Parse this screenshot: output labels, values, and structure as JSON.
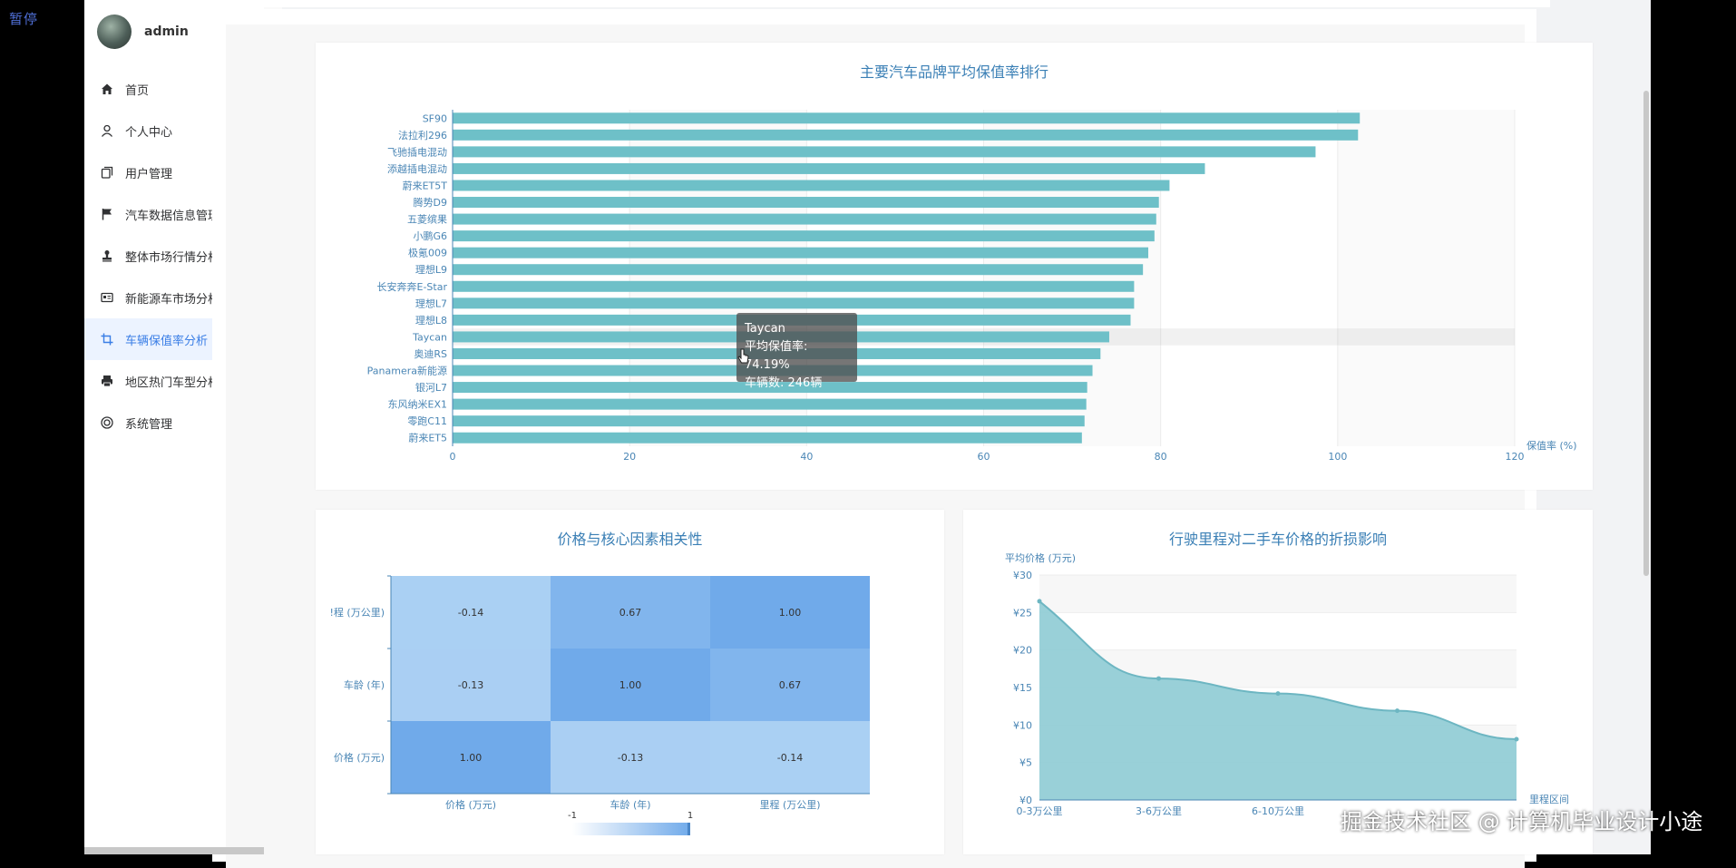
{
  "overlay": {
    "pause_label": "暂停",
    "watermark": "掘金技术社区 @ 计算机毕业设计小途"
  },
  "sidebar": {
    "username": "admin",
    "items": [
      {
        "label": "首页",
        "icon": "home-icon",
        "expand": false,
        "active": false
      },
      {
        "label": "个人中心",
        "icon": "user-icon",
        "expand": true,
        "active": false
      },
      {
        "label": "用户管理",
        "icon": "copy-icon",
        "expand": false,
        "active": false
      },
      {
        "label": "汽车数据信息管理",
        "icon": "flag-icon",
        "expand": false,
        "active": false
      },
      {
        "label": "整体市场行情分析",
        "icon": "stamp-icon",
        "expand": false,
        "active": false
      },
      {
        "label": "新能源车市场分析",
        "icon": "id-card-icon",
        "expand": false,
        "active": false
      },
      {
        "label": "车辆保值率分析",
        "icon": "crop-icon",
        "expand": false,
        "active": true
      },
      {
        "label": "地区热门车型分析",
        "icon": "printer-icon",
        "expand": false,
        "active": false
      },
      {
        "label": "系统管理",
        "icon": "settings-circle-icon",
        "expand": true,
        "active": false
      }
    ]
  },
  "chart_data": [
    {
      "type": "bar",
      "orientation": "horizontal",
      "title": "主要汽车品牌平均保值率排行",
      "xlabel": "保值率 (%)",
      "xlim": [
        0,
        120
      ],
      "xticks": [
        "0",
        "20",
        "40",
        "60",
        "80",
        "100",
        "120"
      ],
      "categories": [
        "SF90",
        "法拉利296",
        "飞驰插电混动",
        "添越插电混动",
        "蔚来ET5T",
        "腾势D9",
        "五菱缤果",
        "小鹏G6",
        "极氪009",
        "理想L9",
        "长安奔奔E-Star",
        "理想L7",
        "理想L8",
        "Taycan",
        "奥迪RS",
        "Panamera新能源",
        "银河L7",
        "东风纳米EX1",
        "零跑C11",
        "蔚来ET5"
      ],
      "values": [
        102.5,
        102.3,
        97.5,
        85,
        81,
        79.8,
        79.5,
        79.3,
        78.6,
        78,
        77,
        77,
        76.6,
        74.19,
        73.2,
        72.3,
        71.7,
        71.6,
        71.4,
        71.1
      ],
      "color": "#6ec0c8",
      "tooltip": {
        "title": "Taycan",
        "line1": "平均保值率: 74.19%",
        "line2": "车辆数: 246辆"
      }
    },
    {
      "type": "heatmap",
      "title": "价格与核心因素相关性",
      "x_categories": [
        "价格 (万元)",
        "车龄 (年)",
        "里程 (万公里)"
      ],
      "y_categories": [
        "价格 (万元)",
        "车龄 (年)",
        "里程 (万公里)"
      ],
      "y_tick_labels": [
        "价格 (万元)",
        "车龄 (年)",
        "!程 (万公里)"
      ],
      "matrix": [
        [
          "1.00",
          "-0.13",
          "-0.14"
        ],
        [
          "-0.13",
          "1.00",
          "0.67"
        ],
        [
          "-0.14",
          "0.67",
          "1.00"
        ]
      ],
      "visual_map": {
        "min": "-1",
        "max": "1"
      }
    },
    {
      "type": "area",
      "title": "行驶里程对二手车价格的折损影响",
      "ylabel": "平均价格 (万元)",
      "xlabel": "里程区间",
      "ylim": [
        0,
        30
      ],
      "yticks": [
        "¥0",
        "¥5",
        "¥10",
        "¥15",
        "¥20",
        "¥25",
        "¥30"
      ],
      "x_labels": [
        "0-3万公里",
        "3-6万公里",
        "6-10万公里",
        "",
        ""
      ],
      "values": [
        26.5,
        16.2,
        14.2,
        11.9,
        8.1
      ],
      "color": "#8ecbd4"
    }
  ]
}
